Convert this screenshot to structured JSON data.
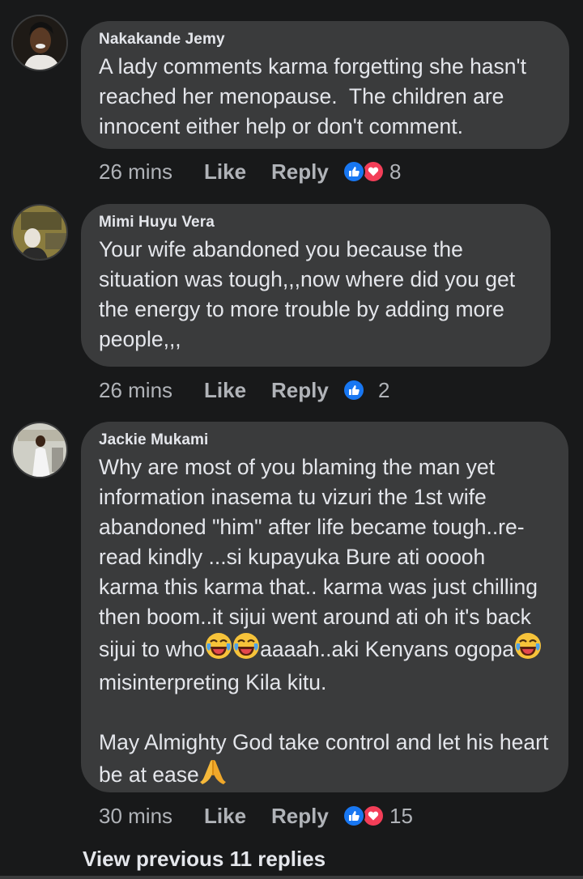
{
  "comments": [
    {
      "author": "Nakakande Jemy",
      "text": "A lady comments karma forgetting she hasn't reached her menopause.  The children are innocent either help or don't comment.",
      "time": "26 mins",
      "like_label": "Like",
      "reply_label": "Reply",
      "reactions": [
        "like-icon",
        "love-icon"
      ],
      "reaction_count": "8"
    },
    {
      "author": "Mimi Huyu Vera",
      "text": "Your wife abandoned you because the situation was tough,,,now where did you get the energy to more trouble by adding more people,,,",
      "time": "26 mins",
      "like_label": "Like",
      "reply_label": "Reply",
      "reactions": [
        "like-icon"
      ],
      "reaction_count": "2"
    },
    {
      "author": "Jackie Mukami",
      "text_part1": "Why are most of you blaming the man yet information inasema tu vizuri the 1st wife abandoned \"him\" after life became tough..re-read kindly ...si kupayuka Bure ati ooooh karma this karma that.. karma was just chilling then boom..it sijui went around ati oh it's back sijui to who",
      "text_part2": "aaaah..aki Kenyans ogopa",
      "text_part3": " misinterpreting Kila kitu.",
      "text_part4": "May Almighty God take control and let his heart be at ease",
      "time": "30 mins",
      "like_label": "Like",
      "reply_label": "Reply",
      "reactions": [
        "like-icon",
        "love-icon"
      ],
      "reaction_count": "15"
    }
  ],
  "view_previous": "View previous 11 replies",
  "colors": {
    "background": "#18191a",
    "bubble": "#3a3b3c",
    "text": "#e4e6eb",
    "secondary": "#b0b3b8",
    "like": "#1877f2",
    "love": "#f33e58"
  }
}
